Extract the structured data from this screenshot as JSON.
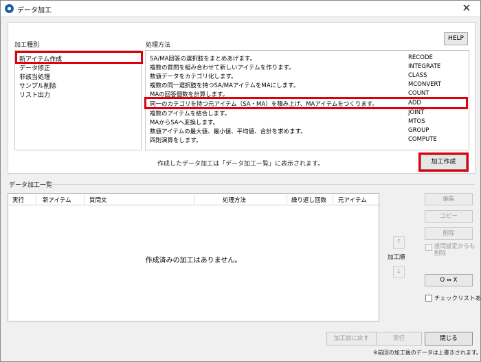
{
  "window": {
    "title": "データ加工",
    "close_glyph": "✕"
  },
  "top_panel": {
    "kind_label": "加工種別",
    "method_label": "処理方法",
    "help_label": "HELP",
    "kinds": [
      "新アイテム作成",
      "データ修正",
      "非該当処理",
      "サンプル削除",
      "リスト出力"
    ],
    "methods": [
      {
        "desc": "SA/MA回答の選択肢をまとめあげます。",
        "code": "RECODE"
      },
      {
        "desc": "複数の質問を組み合わせて新しいアイテムを作ります。",
        "code": "INTEGRATE"
      },
      {
        "desc": "数値データをカテゴリ化します。",
        "code": "CLASS"
      },
      {
        "desc": "複数の同一選択肢を持つSA/MAアイテムをMAにします。",
        "code": "MCONVERT"
      },
      {
        "desc": "MAの回答個数を計算します。",
        "code": "COUNT"
      },
      {
        "desc": "同一のカテゴリを持つ元アイテム（SA・MA）を積み上げ、MAアイテムをつくります。",
        "code": "ADD"
      },
      {
        "desc": "複数のアイテムを結合します。",
        "code": "JOINT"
      },
      {
        "desc": "MAからSAへ変換します。",
        "code": "MTOS"
      },
      {
        "desc": "数値アイテムの最大値、最小値、平均値、合計を求めます。",
        "code": "GROUP"
      },
      {
        "desc": "四則演算をします。",
        "code": "COMPUTE"
      }
    ],
    "info_text": "作成したデータ加工は「データ加工一覧」に表示されます。",
    "create_label": "加工作成"
  },
  "list_panel": {
    "title": "データ加工一覧",
    "columns": [
      "実行",
      "新アイテム",
      "質問文",
      "処理方法",
      "繰り返し回数",
      "元アイテム"
    ],
    "empty_message": "作成済みの加工はありません。"
  },
  "side_actions": {
    "edit_label": "編集",
    "copy_label": "コピー",
    "delete_label": "削除",
    "delete_setting_label": "設問設定からも削除",
    "order_label": "加工順",
    "up_glyph": "↑",
    "down_glyph": "↓",
    "oe_label": "O ⇔ X",
    "checklist_label": "チェックリストあり"
  },
  "bottom": {
    "back_label": "加工前に戻す",
    "run_label": "実行",
    "close_label": "閉じる",
    "note": "※前回の加工後のデータは上書きされます。"
  },
  "colors": {
    "highlight": "#e0000b",
    "accent": "#1f5fa8"
  }
}
